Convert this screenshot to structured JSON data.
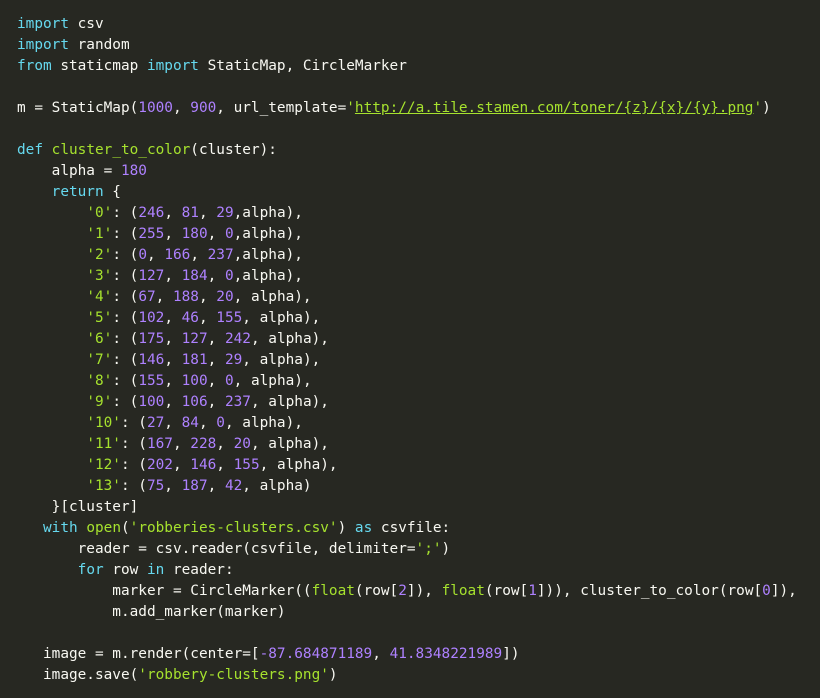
{
  "colors": {
    "background": "#272822",
    "text": "#f8f8f2",
    "keyword": "#66d9ef",
    "function": "#a6e22e",
    "number": "#ae81ff",
    "string": "#a6e22e"
  },
  "code_lines": [
    [
      [
        "kw",
        "import"
      ],
      [
        "tx",
        " csv"
      ]
    ],
    [
      [
        "kw",
        "import"
      ],
      [
        "tx",
        " random"
      ]
    ],
    [
      [
        "kw",
        "from"
      ],
      [
        "tx",
        " staticmap "
      ],
      [
        "kw",
        "import"
      ],
      [
        "tx",
        " StaticMap, CircleMarker"
      ]
    ],
    [],
    [
      [
        "tx",
        "m = StaticMap("
      ],
      [
        "num",
        "1000"
      ],
      [
        "tx",
        ", "
      ],
      [
        "num",
        "900"
      ],
      [
        "tx",
        ", url_template="
      ],
      [
        "str",
        "'"
      ],
      [
        "url",
        "http://a.tile.stamen.com/toner/{z}/{x}/{y}.png"
      ],
      [
        "str",
        "'"
      ],
      [
        "tx",
        ")"
      ]
    ],
    [],
    [
      [
        "kw",
        "def"
      ],
      [
        "tx",
        " "
      ],
      [
        "fn",
        "cluster_to_color"
      ],
      [
        "tx",
        "(cluster):"
      ]
    ],
    [
      [
        "tx",
        "    alpha = "
      ],
      [
        "num",
        "180"
      ]
    ],
    [
      [
        "tx",
        "    "
      ],
      [
        "kw",
        "return"
      ],
      [
        "tx",
        " {"
      ]
    ],
    [
      [
        "tx",
        "        "
      ],
      [
        "str",
        "'0'"
      ],
      [
        "tx",
        ": ("
      ],
      [
        "num",
        "246"
      ],
      [
        "tx",
        ", "
      ],
      [
        "num",
        "81"
      ],
      [
        "tx",
        ", "
      ],
      [
        "num",
        "29"
      ],
      [
        "tx",
        ",alpha),"
      ]
    ],
    [
      [
        "tx",
        "        "
      ],
      [
        "str",
        "'1'"
      ],
      [
        "tx",
        ": ("
      ],
      [
        "num",
        "255"
      ],
      [
        "tx",
        ", "
      ],
      [
        "num",
        "180"
      ],
      [
        "tx",
        ", "
      ],
      [
        "num",
        "0"
      ],
      [
        "tx",
        ",alpha),"
      ]
    ],
    [
      [
        "tx",
        "        "
      ],
      [
        "str",
        "'2'"
      ],
      [
        "tx",
        ": ("
      ],
      [
        "num",
        "0"
      ],
      [
        "tx",
        ", "
      ],
      [
        "num",
        "166"
      ],
      [
        "tx",
        ", "
      ],
      [
        "num",
        "237"
      ],
      [
        "tx",
        ",alpha),"
      ]
    ],
    [
      [
        "tx",
        "        "
      ],
      [
        "str",
        "'3'"
      ],
      [
        "tx",
        ": ("
      ],
      [
        "num",
        "127"
      ],
      [
        "tx",
        ", "
      ],
      [
        "num",
        "184"
      ],
      [
        "tx",
        ", "
      ],
      [
        "num",
        "0"
      ],
      [
        "tx",
        ",alpha),"
      ]
    ],
    [
      [
        "tx",
        "        "
      ],
      [
        "str",
        "'4'"
      ],
      [
        "tx",
        ": ("
      ],
      [
        "num",
        "67"
      ],
      [
        "tx",
        ", "
      ],
      [
        "num",
        "188"
      ],
      [
        "tx",
        ", "
      ],
      [
        "num",
        "20"
      ],
      [
        "tx",
        ", alpha),"
      ]
    ],
    [
      [
        "tx",
        "        "
      ],
      [
        "str",
        "'5'"
      ],
      [
        "tx",
        ": ("
      ],
      [
        "num",
        "102"
      ],
      [
        "tx",
        ", "
      ],
      [
        "num",
        "46"
      ],
      [
        "tx",
        ", "
      ],
      [
        "num",
        "155"
      ],
      [
        "tx",
        ", alpha),"
      ]
    ],
    [
      [
        "tx",
        "        "
      ],
      [
        "str",
        "'6'"
      ],
      [
        "tx",
        ": ("
      ],
      [
        "num",
        "175"
      ],
      [
        "tx",
        ", "
      ],
      [
        "num",
        "127"
      ],
      [
        "tx",
        ", "
      ],
      [
        "num",
        "242"
      ],
      [
        "tx",
        ", alpha),"
      ]
    ],
    [
      [
        "tx",
        "        "
      ],
      [
        "str",
        "'7'"
      ],
      [
        "tx",
        ": ("
      ],
      [
        "num",
        "146"
      ],
      [
        "tx",
        ", "
      ],
      [
        "num",
        "181"
      ],
      [
        "tx",
        ", "
      ],
      [
        "num",
        "29"
      ],
      [
        "tx",
        ", alpha),"
      ]
    ],
    [
      [
        "tx",
        "        "
      ],
      [
        "str",
        "'8'"
      ],
      [
        "tx",
        ": ("
      ],
      [
        "num",
        "155"
      ],
      [
        "tx",
        ", "
      ],
      [
        "num",
        "100"
      ],
      [
        "tx",
        ", "
      ],
      [
        "num",
        "0"
      ],
      [
        "tx",
        ", alpha),"
      ]
    ],
    [
      [
        "tx",
        "        "
      ],
      [
        "str",
        "'9'"
      ],
      [
        "tx",
        ": ("
      ],
      [
        "num",
        "100"
      ],
      [
        "tx",
        ", "
      ],
      [
        "num",
        "106"
      ],
      [
        "tx",
        ", "
      ],
      [
        "num",
        "237"
      ],
      [
        "tx",
        ", alpha),"
      ]
    ],
    [
      [
        "tx",
        "        "
      ],
      [
        "str",
        "'10'"
      ],
      [
        "tx",
        ": ("
      ],
      [
        "num",
        "27"
      ],
      [
        "tx",
        ", "
      ],
      [
        "num",
        "84"
      ],
      [
        "tx",
        ", "
      ],
      [
        "num",
        "0"
      ],
      [
        "tx",
        ", alpha),"
      ]
    ],
    [
      [
        "tx",
        "        "
      ],
      [
        "str",
        "'11'"
      ],
      [
        "tx",
        ": ("
      ],
      [
        "num",
        "167"
      ],
      [
        "tx",
        ", "
      ],
      [
        "num",
        "228"
      ],
      [
        "tx",
        ", "
      ],
      [
        "num",
        "20"
      ],
      [
        "tx",
        ", alpha),"
      ]
    ],
    [
      [
        "tx",
        "        "
      ],
      [
        "str",
        "'12'"
      ],
      [
        "tx",
        ": ("
      ],
      [
        "num",
        "202"
      ],
      [
        "tx",
        ", "
      ],
      [
        "num",
        "146"
      ],
      [
        "tx",
        ", "
      ],
      [
        "num",
        "155"
      ],
      [
        "tx",
        ", alpha),"
      ]
    ],
    [
      [
        "tx",
        "        "
      ],
      [
        "str",
        "'13'"
      ],
      [
        "tx",
        ": ("
      ],
      [
        "num",
        "75"
      ],
      [
        "tx",
        ", "
      ],
      [
        "num",
        "187"
      ],
      [
        "tx",
        ", "
      ],
      [
        "num",
        "42"
      ],
      [
        "tx",
        ", alpha)"
      ]
    ],
    [
      [
        "tx",
        "    }[cluster]"
      ]
    ],
    [
      [
        "tx",
        "   "
      ],
      [
        "kw",
        "with"
      ],
      [
        "tx",
        " "
      ],
      [
        "fn",
        "open"
      ],
      [
        "tx",
        "("
      ],
      [
        "str",
        "'robberies-clusters.csv'"
      ],
      [
        "tx",
        ") "
      ],
      [
        "kw",
        "as"
      ],
      [
        "tx",
        " csvfile:"
      ]
    ],
    [
      [
        "tx",
        "       reader = csv.reader(csvfile, delimiter="
      ],
      [
        "str",
        "';'"
      ],
      [
        "tx",
        ")"
      ]
    ],
    [
      [
        "tx",
        "       "
      ],
      [
        "kw",
        "for"
      ],
      [
        "tx",
        " row "
      ],
      [
        "kw",
        "in"
      ],
      [
        "tx",
        " reader:"
      ]
    ],
    [
      [
        "tx",
        "           marker = CircleMarker(("
      ],
      [
        "fn",
        "float"
      ],
      [
        "tx",
        "(row["
      ],
      [
        "num",
        "2"
      ],
      [
        "tx",
        "]), "
      ],
      [
        "fn",
        "float"
      ],
      [
        "tx",
        "(row["
      ],
      [
        "num",
        "1"
      ],
      [
        "tx",
        "])), cluster_to_color(row["
      ],
      [
        "num",
        "0"
      ],
      [
        "tx",
        "]),"
      ]
    ],
    [
      [
        "tx",
        "           m.add_marker(marker)"
      ]
    ],
    [],
    [
      [
        "tx",
        "   image = m.render(center=["
      ],
      [
        "num",
        "-87.684871189"
      ],
      [
        "tx",
        ", "
      ],
      [
        "num",
        "41.8348221989"
      ],
      [
        "tx",
        "])"
      ]
    ],
    [
      [
        "tx",
        "   image.save("
      ],
      [
        "str",
        "'robbery-clusters.png'"
      ],
      [
        "tx",
        ")"
      ]
    ]
  ]
}
